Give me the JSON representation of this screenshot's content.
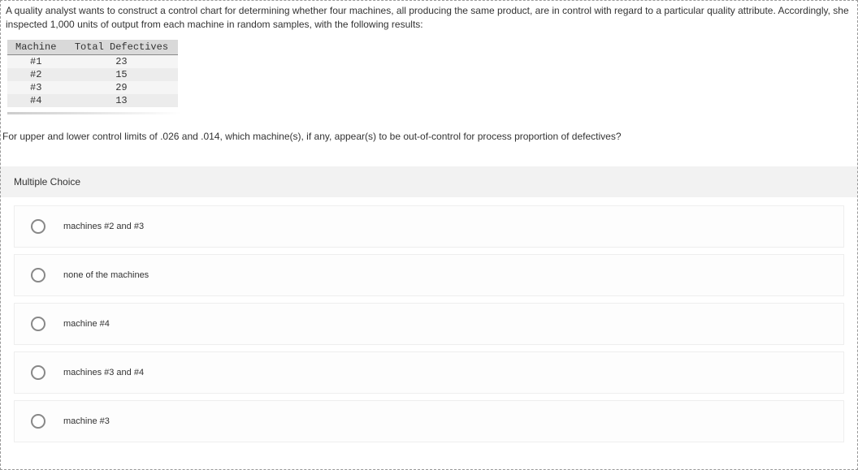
{
  "question": {
    "intro": "A quality analyst wants to construct a control chart for determining whether four machines, all producing the same product, are in control with regard to a particular quality attribute. Accordingly, she inspected 1,000 units of output from each machine in random samples, with the following results:",
    "table": {
      "headers": [
        "Machine",
        "Total Defectives"
      ],
      "rows": [
        {
          "machine": "#1",
          "defectives": "23"
        },
        {
          "machine": "#2",
          "defectives": "15"
        },
        {
          "machine": "#3",
          "defectives": "29"
        },
        {
          "machine": "#4",
          "defectives": "13"
        }
      ]
    },
    "followup": "For upper and lower control limits of .026 and .014, which machine(s), if any, appear(s) to be out-of-control for process proportion of defectives?"
  },
  "mc_label": "Multiple Choice",
  "choices": [
    {
      "label": "machines #2 and #3"
    },
    {
      "label": "none of the machines"
    },
    {
      "label": "machine #4"
    },
    {
      "label": "machines #3 and #4"
    },
    {
      "label": "machine #3"
    }
  ]
}
